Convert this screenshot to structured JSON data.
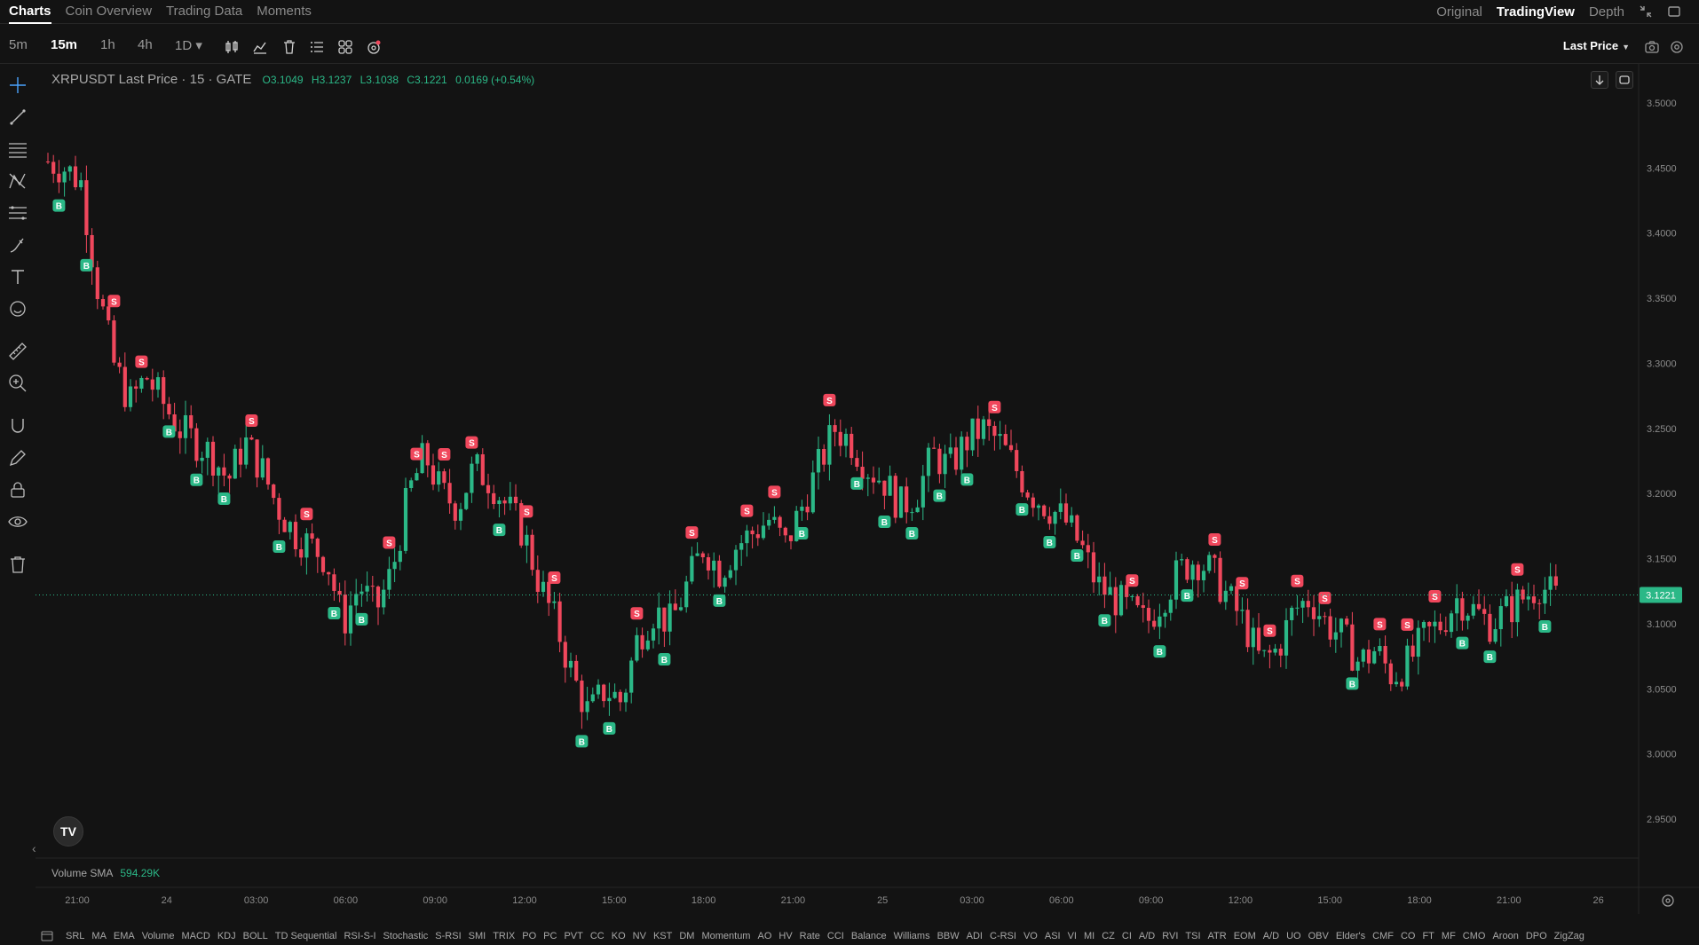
{
  "top_tabs": [
    "Charts",
    "Coin Overview",
    "Trading Data",
    "Moments"
  ],
  "active_top_tab": "Charts",
  "view_tabs": [
    "Original",
    "TradingView",
    "Depth"
  ],
  "active_view_tab": "TradingView",
  "intervals": [
    "5m",
    "15m",
    "1h",
    "4h",
    "1D ▾"
  ],
  "active_interval": "15m",
  "price_source": "Last Price",
  "legend": {
    "symbol": "XRPUSDT Last Price · 15 · GATE",
    "open": "O3.1049",
    "high": "H3.1237",
    "low": "L3.1038",
    "close": "C3.1221",
    "change": "0.0169 (+0.54%)"
  },
  "volume": {
    "label": "Volume SMA",
    "value": "594.29K"
  },
  "logo_text": "TV",
  "colors": {
    "up": "#2bb887",
    "down": "#f0475c",
    "background": "#131313",
    "grid": "#1f1f1f",
    "price_line": "#2bb887"
  },
  "indicators": [
    "SRL",
    "MA",
    "EMA",
    "Volume",
    "MACD",
    "KDJ",
    "BOLL",
    "TD Sequential",
    "RSI-S-I",
    "Stochastic",
    "S-RSI",
    "SMI",
    "TRIX",
    "PO",
    "PC",
    "PVT",
    "CC",
    "KO",
    "NV",
    "KST",
    "DM",
    "Momentum",
    "AO",
    "HV",
    "Rate",
    "CCI",
    "Balance",
    "Williams",
    "BBW",
    "ADI",
    "C-RSI",
    "VO",
    "ASI",
    "VI",
    "MI",
    "CZ",
    "CI",
    "A/D",
    "RVI",
    "TSI",
    "ATR",
    "EOM",
    "A/D",
    "UO",
    "OBV",
    "Elder's",
    "CMF",
    "CO",
    "FT",
    "MF",
    "CMO",
    "Aroon",
    "DPO",
    "ZigZag"
  ],
  "chart_data": {
    "type": "candlestick",
    "symbol": "XRPUSDT",
    "ylim": [
      2.92,
      3.53
    ],
    "y_ticks": [
      "3.5000",
      "3.4500",
      "3.4000",
      "3.3500",
      "3.3000",
      "3.2500",
      "3.2000",
      "3.1500",
      "3.1000",
      "3.0500",
      "3.0000",
      "2.9500"
    ],
    "x_ticks": [
      "21:00",
      "24",
      "03:00",
      "06:00",
      "09:00",
      "12:00",
      "15:00",
      "18:00",
      "21:00",
      "25",
      "03:00",
      "06:00",
      "09:00",
      "12:00",
      "15:00",
      "18:00",
      "21:00",
      "26"
    ],
    "last_price": "3.1221",
    "close_path": [
      3.455,
      3.45,
      3.44,
      3.36,
      3.3,
      3.27,
      3.29,
      3.27,
      3.25,
      3.24,
      3.23,
      3.21,
      3.24,
      3.22,
      3.19,
      3.17,
      3.16,
      3.15,
      3.1,
      3.13,
      3.11,
      3.14,
      3.2,
      3.23,
      3.2,
      3.19,
      3.22,
      3.21,
      3.19,
      3.17,
      3.13,
      3.1,
      3.06,
      3.03,
      3.05,
      3.04,
      3.09,
      3.11,
      3.1,
      3.13,
      3.16,
      3.14,
      3.16,
      3.17,
      3.18,
      3.16,
      3.19,
      3.22,
      3.25,
      3.24,
      3.22,
      3.21,
      3.19,
      3.2,
      3.23,
      3.22,
      3.24,
      3.25,
      3.24,
      3.22,
      3.2,
      3.19,
      3.18,
      3.16,
      3.13,
      3.12,
      3.11,
      3.1,
      3.12,
      3.14,
      3.15,
      3.14,
      3.12,
      3.1,
      3.07,
      3.08,
      3.11,
      3.12,
      3.1,
      3.09,
      3.07,
      3.08,
      3.06,
      3.07,
      3.09,
      3.1,
      3.12,
      3.11,
      3.1,
      3.11,
      3.12,
      3.13,
      3.12
    ],
    "markers_note": "B = buy signal below candle, S = sell signal above candle"
  }
}
